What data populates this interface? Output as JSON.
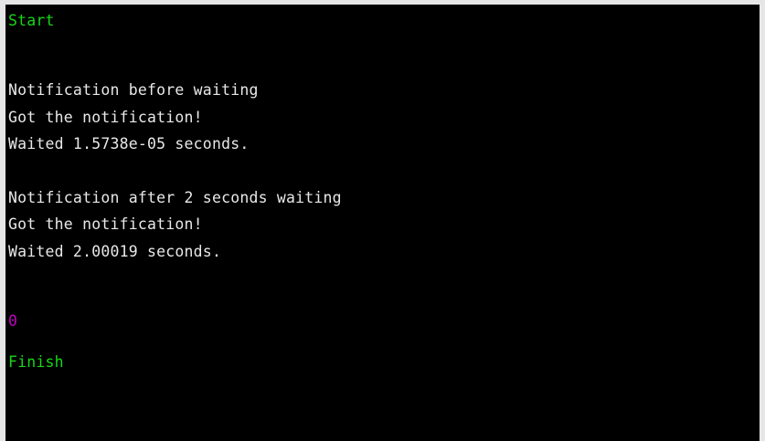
{
  "colors": {
    "background": "#000000",
    "frame": "#e6e6e6",
    "green": "#17d617",
    "white": "#e8e8e8",
    "magenta": "#c000c0"
  },
  "terminal": {
    "lines": [
      {
        "text": "Start",
        "color": "green"
      },
      {
        "text": "Notification before waiting",
        "color": "white"
      },
      {
        "text": "Got the notification!",
        "color": "white"
      },
      {
        "text": "Waited 1.5738e-05 seconds.",
        "color": "white"
      },
      {
        "text": "Notification after 2 seconds waiting",
        "color": "white"
      },
      {
        "text": "Got the notification!",
        "color": "white"
      },
      {
        "text": "Waited 2.00019 seconds.",
        "color": "white"
      },
      {
        "text": "0",
        "color": "magenta"
      },
      {
        "text": "Finish",
        "color": "green"
      }
    ]
  }
}
